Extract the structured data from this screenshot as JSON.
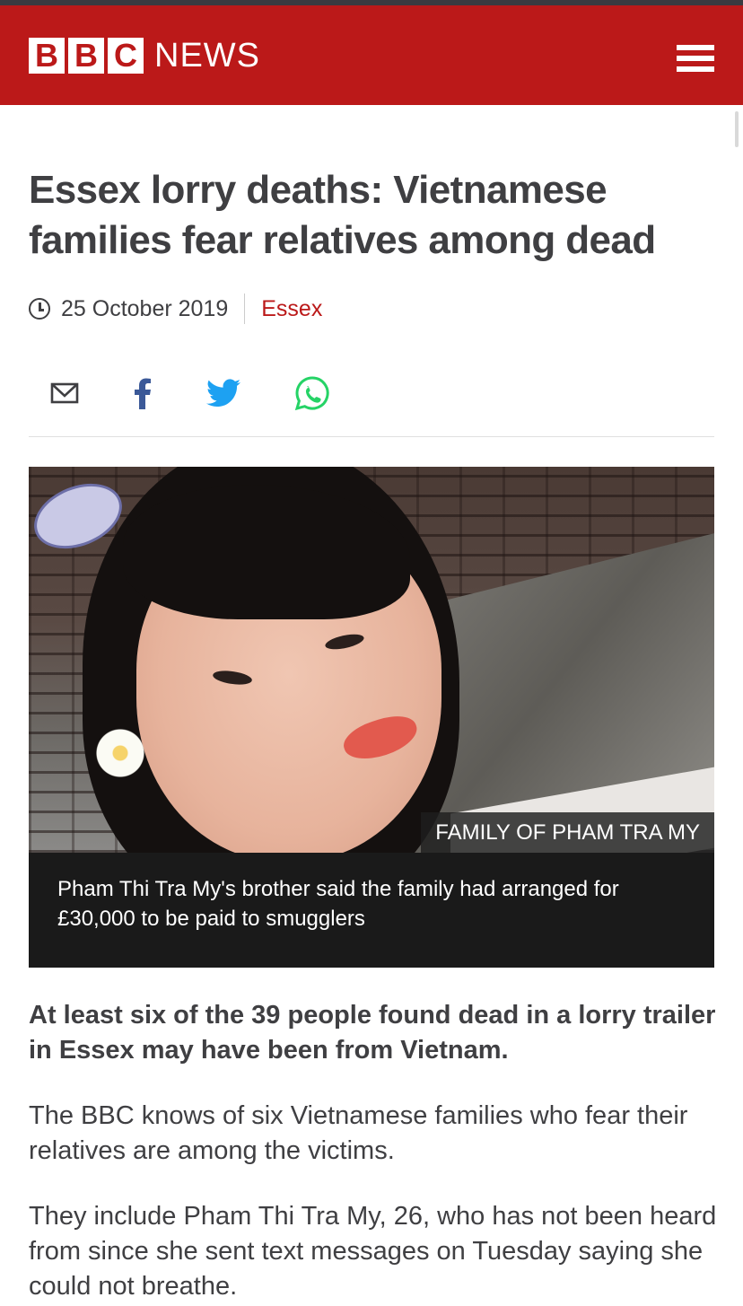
{
  "header": {
    "logo_letters": [
      "B",
      "B",
      "C"
    ],
    "logo_word": "NEWS",
    "menu_icon": "hamburger-menu-icon",
    "brand_color": "#bb1919"
  },
  "article": {
    "headline": "Essex lorry deaths: Vietnamese families fear relatives among dead",
    "date": "25 October 2019",
    "section": "Essex",
    "share_icons": [
      "email-icon",
      "facebook-icon",
      "twitter-icon",
      "whatsapp-icon"
    ],
    "image": {
      "credit": "FAMILY OF PHAM TRA MY",
      "caption": "Pham Thi Tra My's brother said the family had arranged for £30,000 to be paid to smugglers"
    },
    "lead": "At least six of the 39 people found dead in a lorry trailer in Essex may have been from Vietnam.",
    "paragraphs": [
      "The BBC knows of six Vietnamese families who fear their relatives are among the victims.",
      "They include Pham Thi Tra My, 26, who has not been heard from since she sent text messages on Tuesday saying she could not breathe."
    ]
  }
}
